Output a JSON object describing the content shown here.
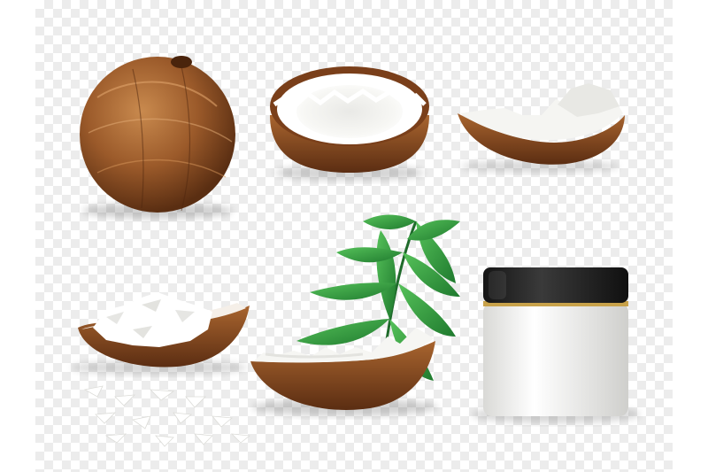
{
  "scene": {
    "background": "transparency-checkerboard",
    "colors": {
      "checker_light": "#ffffff",
      "checker_dark": "#ececec",
      "shell_brown": "#8a4b22",
      "shell_dark": "#5b2d12",
      "coconut_flesh": "#f4f3ef",
      "palm_leaf": "#2f9a3d",
      "jar_lid": "#1e1e1e",
      "jar_rim_gold": "#c8a24a",
      "jar_body": "#f2f2f0"
    },
    "objects": [
      {
        "id": "whole-coconut",
        "icon": "whole-coconut-icon"
      },
      {
        "id": "coconut-half",
        "icon": "coconut-half-icon"
      },
      {
        "id": "coconut-piece",
        "icon": "coconut-piece-icon"
      },
      {
        "id": "coconut-flakes-in-shell",
        "icon": "coconut-flakes-icon"
      },
      {
        "id": "scattered-flakes",
        "icon": "flakes-icon"
      },
      {
        "id": "broken-coconut-shell",
        "icon": "broken-coconut-icon"
      },
      {
        "id": "palm-leaf",
        "icon": "palm-leaf-icon"
      },
      {
        "id": "cosmetic-jar",
        "icon": "cream-jar-icon"
      }
    ]
  }
}
